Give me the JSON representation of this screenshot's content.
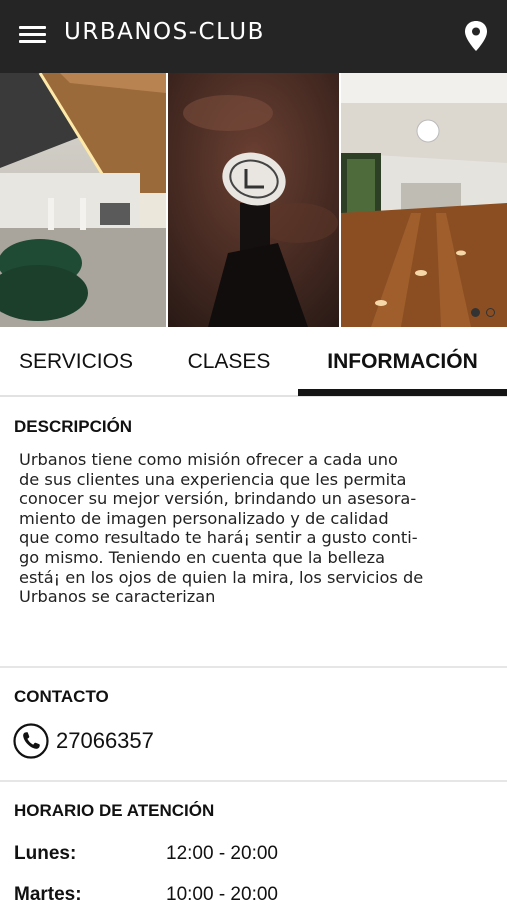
{
  "app": {
    "title": "URBANOS-CLUB",
    "menu_icon": "hamburger-menu-icon",
    "location_icon": "map-pin-icon"
  },
  "gallery": {
    "images": [
      "lounge-interior-photo",
      "illuminated-sign-photo",
      "wood-floor-hall-photo"
    ],
    "page_count": 2,
    "active_page": 1
  },
  "tabs": [
    {
      "label": "SERVICIOS",
      "active": false
    },
    {
      "label": "CLASES",
      "active": false
    },
    {
      "label": "INFORMACIÓN",
      "active": true
    }
  ],
  "description": {
    "title": "DESCRIPCIÓN",
    "lines": [
      "Urbanos tiene como misión ofrecer a cada uno",
      "de sus clientes una experiencia que les permita",
      "conocer su mejor versión, brindando un asesora-",
      "miento de imagen personalizado y de calidad",
      "que como resultado te hará¡ sentir a gusto conti-",
      "go mismo. Teniendo en cuenta que la belleza",
      "está¡ en los ojos de quien la mira, los servicios de",
      "Urbanos se caracterizan"
    ]
  },
  "contact": {
    "title": "CONTACTO",
    "phone_icon": "phone-icon",
    "phone": "27066357"
  },
  "schedule": {
    "title": "HORARIO DE ATENCIÓN",
    "rows": [
      {
        "day": "Lunes:",
        "hours": "12:00 - 20:00"
      },
      {
        "day": "Martes:",
        "hours": "10:00 - 20:00"
      }
    ]
  },
  "colors": {
    "appbar": "#252525",
    "tab_indicator": "#141414",
    "divider": "#e6e6e6"
  }
}
